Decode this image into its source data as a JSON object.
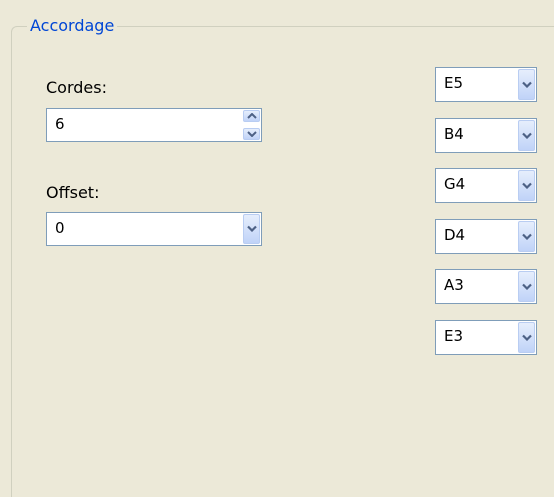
{
  "group": {
    "title": "Accordage"
  },
  "strings_field": {
    "label": "Cordes:",
    "value": "6"
  },
  "offset_field": {
    "label": "Offset:",
    "value": "0"
  },
  "tuning": [
    {
      "note": "E5"
    },
    {
      "note": "B4"
    },
    {
      "note": "G4"
    },
    {
      "note": "D4"
    },
    {
      "note": "A3"
    },
    {
      "note": "E3"
    }
  ],
  "icons": {
    "dropdown": "chevron-down-icon",
    "spin_up": "chevron-up-icon",
    "spin_down": "chevron-down-icon"
  },
  "colors": {
    "window_bg": "#ece9d8",
    "group_title": "#0046d5",
    "control_border": "#7f9db9",
    "button_arrow": "#4d6185"
  }
}
